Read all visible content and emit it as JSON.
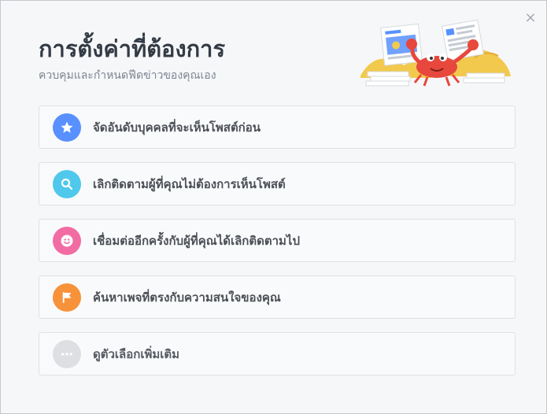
{
  "dialog": {
    "title": "การตั้งค่าที่ต้องการ",
    "subtitle": "ควบคุมและกำหนดฟีดข่าวของคุณเอง",
    "close_icon": "close-icon",
    "items": [
      {
        "label": "จัดอันดับบุคคลที่จะเห็นโพสต์ก่อน",
        "icon": "star-icon",
        "color": "#5890ff"
      },
      {
        "label": "เลิกติดตามผู้ที่คุณไม่ต้องการเห็นโพสต์",
        "icon": "search-icon",
        "color": "#4fc8ec"
      },
      {
        "label": "เชื่อมต่ออีกครั้งกับผู้ที่คุณได้เลิกติดตามไป",
        "icon": "smiley-icon",
        "color": "#f26ca4"
      },
      {
        "label": "ค้นหาเพจที่ตรงกับความสนใจของคุณ",
        "icon": "flag-icon",
        "color": "#f7923b"
      },
      {
        "label": "ดูตัวเลือกเพิ่มเติม",
        "icon": "more-icon",
        "color": "#dddfe2"
      }
    ]
  }
}
